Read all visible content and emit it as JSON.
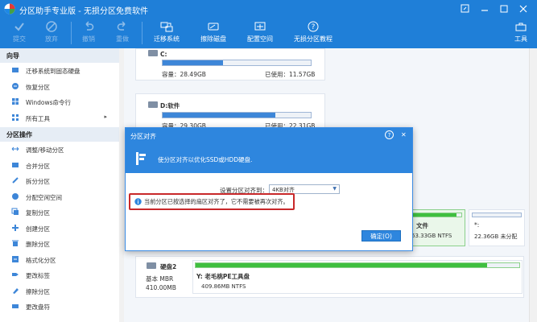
{
  "app": {
    "title": "分区助手专业版 - 无损分区免费软件"
  },
  "toolbar": {
    "commit": "提交",
    "discard": "放弃",
    "undo": "撤销",
    "redo": "重做",
    "migrate": "迁移系统",
    "defrag": "擦除磁盘",
    "config": "配置空间",
    "tutorial": "无损分区教程",
    "tools": "工具"
  },
  "sidebar": {
    "wizard_title": "向导",
    "wizard_items": [
      {
        "label": "迁移系统到固态硬盘"
      },
      {
        "label": "恢复分区"
      },
      {
        "label": "Windows命令行"
      },
      {
        "label": "所有工具",
        "arrow": "▸"
      }
    ],
    "ops_title": "分区操作",
    "ops_items": [
      {
        "label": "调整/移动分区"
      },
      {
        "label": "合并分区"
      },
      {
        "label": "拆分分区"
      },
      {
        "label": "分配空闲空间"
      },
      {
        "label": "复制分区"
      },
      {
        "label": "创建分区"
      },
      {
        "label": "删除分区"
      },
      {
        "label": "格式化分区"
      },
      {
        "label": "更改标签"
      },
      {
        "label": "擦除分区"
      },
      {
        "label": "更改盘符"
      }
    ]
  },
  "disk1": {
    "c": {
      "name": "C:",
      "capacity": "容量：28.49GB",
      "used": "已使用：11.57GB",
      "used_fraction": 0.41
    },
    "d": {
      "name": "D:软件",
      "capacity": "容量：29.30GB",
      "used": "已使用：22.31GB",
      "used_fraction": 0.76
    },
    "e": {
      "name": "文件",
      "size": "63.33GB NTFS",
      "used_fraction": 0.9
    },
    "star": {
      "name": "*:",
      "size": "22.36GB 未分配"
    }
  },
  "disk2": {
    "name": "硬盘2",
    "type": "基本 MBR",
    "size": "410.00MB",
    "part_name": "Y: 老毛桃PE工具盘",
    "part_size": "409.86MB NTFS",
    "used_fraction": 0.9
  },
  "dialog": {
    "title": "分区对齐",
    "help": "?",
    "close": "✕",
    "heading": "使分区对齐以优化SSD或HDD硬盘.",
    "setting_label": "设置分区对齐到：",
    "setting_value": "4KB对齐",
    "warning": "当前分区已按选择的扇区对齐了，它不需要被再次对齐。",
    "ok": "确定(O)"
  },
  "colors": {
    "accent": "#1f7fd8",
    "warning_border": "#c8282a",
    "bar": "#3d86d8",
    "green": "#3fbf3f"
  }
}
